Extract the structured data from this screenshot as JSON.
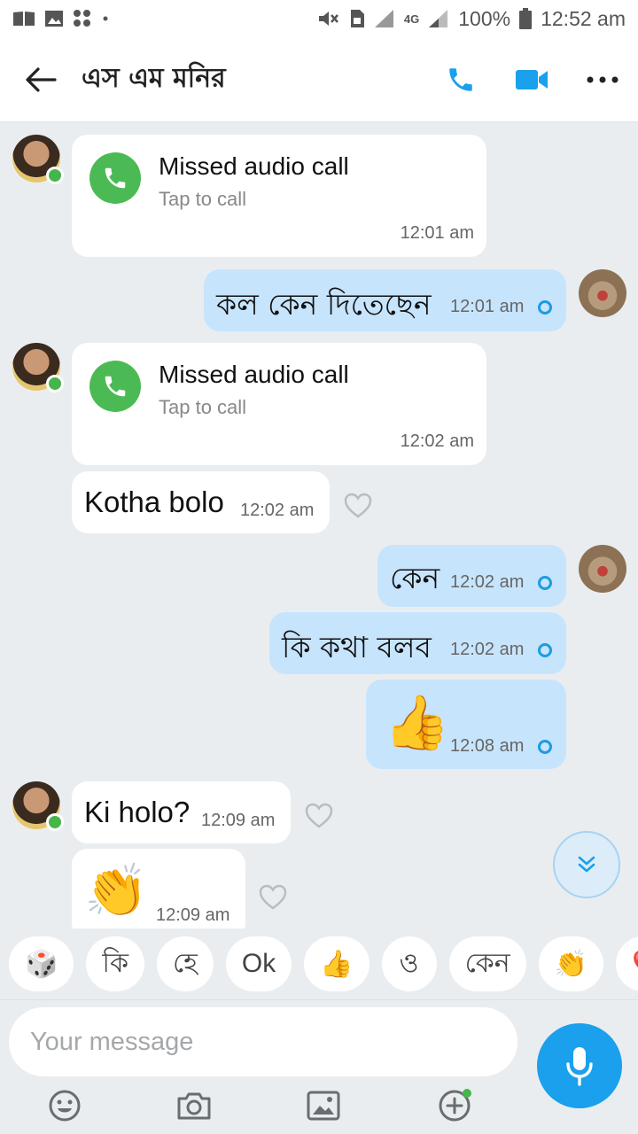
{
  "status_bar": {
    "left_icons": [
      "book-icon",
      "image-icon",
      "apps-icon",
      "dot-icon"
    ],
    "signal_label": "4G",
    "battery": "100%",
    "time": "12:52 am"
  },
  "header": {
    "contact_name": "এস এম মনির",
    "icons": [
      "back-arrow-icon",
      "phone-icon",
      "video-camera-icon",
      "more-icon"
    ]
  },
  "messages": [
    {
      "from": "them",
      "kind": "call",
      "title": "Missed audio call",
      "subtitle": "Tap to call",
      "time": "12:01 am"
    },
    {
      "from": "me",
      "kind": "text",
      "text": "কল কেন দিতেছেন",
      "time": "12:01 am"
    },
    {
      "from": "them",
      "kind": "call",
      "title": "Missed audio call",
      "subtitle": "Tap to call",
      "time": "12:02 am"
    },
    {
      "from": "them",
      "kind": "text",
      "text": "Kotha bolo",
      "time": "12:02 am"
    },
    {
      "from": "me",
      "kind": "text",
      "text": "কেন",
      "time": "12:02 am"
    },
    {
      "from": "me",
      "kind": "text",
      "text": "কি কথা বলব",
      "time": "12:02 am"
    },
    {
      "from": "me",
      "kind": "emoji",
      "emoji": "👍",
      "time": "12:08 am"
    },
    {
      "from": "them",
      "kind": "text",
      "text": "Ki holo?",
      "time": "12:09 am"
    },
    {
      "from": "them",
      "kind": "emoji",
      "emoji": "👏",
      "time": "12:09 am"
    }
  ],
  "quick_replies": [
    "🎲",
    "কি",
    "হে",
    "Ok",
    "👍",
    "ও",
    "কেন",
    "👏",
    "❤️"
  ],
  "composer": {
    "placeholder": "Your message",
    "tools": [
      "emoji-icon",
      "camera-icon",
      "gallery-icon",
      "add-icon"
    ],
    "colors": {
      "accent": "#1aa0ec",
      "online": "#45b649",
      "outgoing_bubble": "#c7e4fd"
    }
  }
}
